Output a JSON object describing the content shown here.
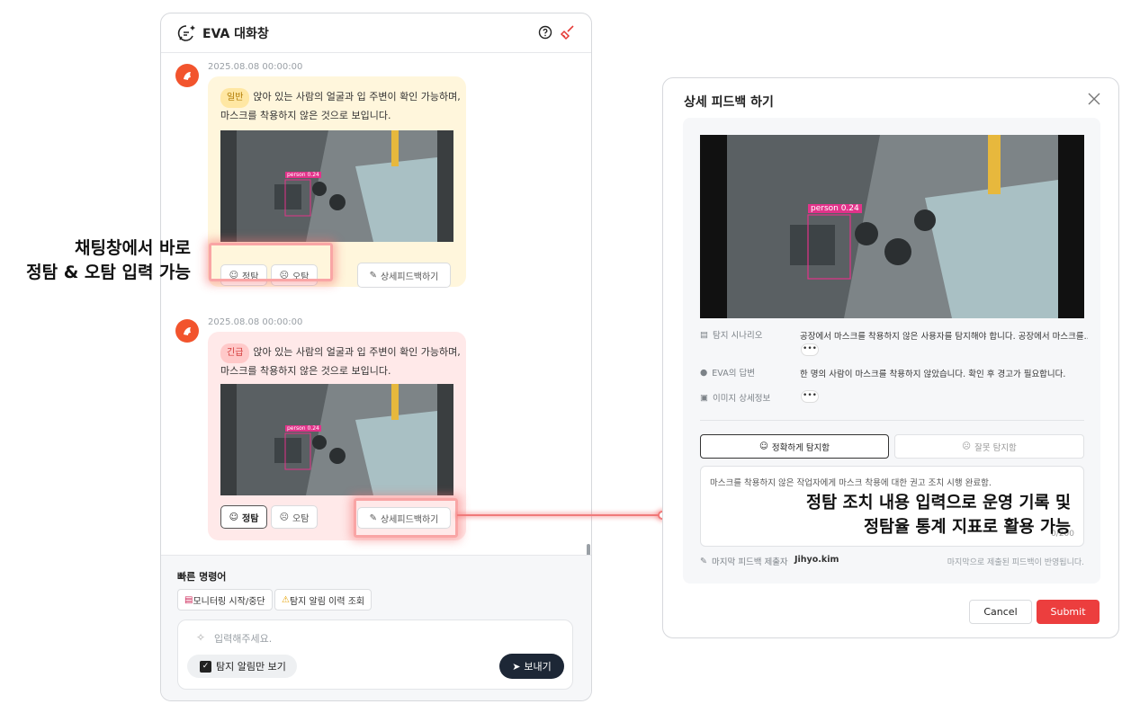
{
  "chat": {
    "title": "EVA 대화창",
    "messages": [
      {
        "timestamp": "2025.08.08 00:00:00",
        "tag": "일반",
        "text_line1": "앉아 있는 사람의 얼굴과 입 주변이 확인 가능하며,",
        "text_line2": "마스크를 착용하지 않은 것으로 보입니다.",
        "detection_label": "person 0.24",
        "correct_label": "정탐",
        "wrong_label": "오탐",
        "detail_label": "상세피드백하기"
      },
      {
        "timestamp": "2025.08.08 00:00:00",
        "tag": "긴급",
        "text_line1": "앉아 있는 사람의 얼굴과 입 주변이 확인 가능하며,",
        "text_line2": "마스크를 착용하지 않은 것으로 보입니다.",
        "detection_label": "person 0.24",
        "correct_label": "정탐",
        "wrong_label": "오탐",
        "detail_label": "상세피드백하기"
      }
    ],
    "quick_title": "빠른 명령어",
    "quick_commands": [
      "모니터링 시작/중단",
      "탐지 알림 이력 조회"
    ],
    "input_placeholder": "입력해주세요.",
    "checkbox_label": "탐지 알림만 보기",
    "checkbox_checked": true,
    "send_label": "보내기"
  },
  "callouts": {
    "left_line1": "채팅창에서 바로",
    "left_line2": "정탐 & 오탐 입력 가능",
    "right_line1": "정탐 조치 내용 입력으로 운영 기록 및",
    "right_line2": "정탐율 통계 지표로 활용 가능"
  },
  "modal": {
    "title": "상세 피드백 하기",
    "detection_label": "person 0.24",
    "scenario_label": "탐지 시나리오",
    "scenario_value": "공장에서 마스크를 착용하지 않은 사용자를 탐지해야 합니다. 공장에서 마스크를..",
    "answer_label": "EVA의 답변",
    "answer_value": "한 명의 사람이 마스크를 착용하지 않았습니다. 확인 후 경고가 필요합니다.",
    "image_info_label": "이미지 상세정보",
    "more_label": "•••",
    "correct_option": "정확하게 탐지함",
    "wrong_option": "잘못 탐지함",
    "feedback_text": "마스크를 착용하지 않은 작업자에게 마스크 착용에 대한 권고 조치 시행 완료함.",
    "char_count": "0/200",
    "submitter_label": "마지막 피드백 제출자",
    "submitter_name": "Jihyo.kim",
    "note": "마지막으로 제출된 피드백이 반영됩니다.",
    "cancel_label": "Cancel",
    "submit_label": "Submit"
  },
  "colors": {
    "accent": "#f2542d",
    "submit": "#ec3e3e",
    "normal_bubble": "#fff6dc",
    "urgent_bubble": "#ffe9e9",
    "detection_box": "#e2338a"
  }
}
